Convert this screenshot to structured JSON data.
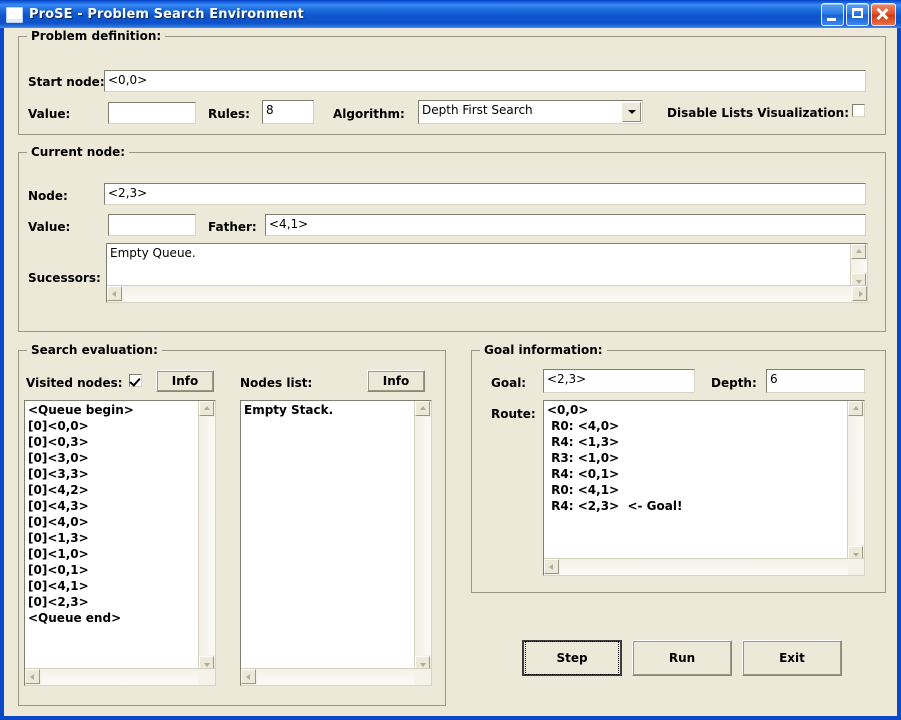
{
  "window": {
    "title": "ProSE - Problem Search Environment",
    "icon": "app-window-icon",
    "controls": {
      "minimize": "minimize-icon",
      "maximize": "maximize-icon",
      "close": "close-icon"
    },
    "colors": {
      "titlebar_blue": "#0d55cf",
      "titlebar_border": "#0a48c8",
      "face": "#ece9d8",
      "field_bg": "#ffffff",
      "close_red": "#cf3b14",
      "border_gray": "#9b9784"
    }
  },
  "problem_definition": {
    "legend": "Problem definition:",
    "start_node_label": "Start node:",
    "start_node_value": "<0,0>",
    "value_label": "Value:",
    "value_value": "",
    "rules_label": "Rules:",
    "rules_value": "8",
    "algorithm_label": "Algorithm:",
    "algorithm_value": "Depth First Search",
    "algorithm_options": [
      "Depth First Search"
    ],
    "disable_lists_label": "Disable Lists Visualization:",
    "disable_lists_checked": false
  },
  "current_node": {
    "legend": "Current node:",
    "node_label": "Node:",
    "node_value": "<2,3>",
    "value_label": "Value:",
    "value_value": "",
    "father_label": "Father:",
    "father_value": "<4,1>",
    "sucessors_label": "Sucessors:",
    "sucessors_text": "Empty Queue."
  },
  "search_evaluation": {
    "legend": "Search evaluation:",
    "visited_nodes_label": "Visited nodes:",
    "visited_nodes_checked": true,
    "visited_info_button": "Info",
    "nodes_list_label": "Nodes list:",
    "nodes_list_info_button": "Info",
    "visited_nodes_items": [
      "<Queue begin>",
      "[0]<0,0>",
      "[0]<0,3>",
      "[0]<3,0>",
      "[0]<3,3>",
      "[0]<4,2>",
      "[0]<4,3>",
      "[0]<4,0>",
      "[0]<1,3>",
      "[0]<1,0>",
      "[0]<0,1>",
      "[0]<4,1>",
      "[0]<2,3>",
      "<Queue end>"
    ],
    "nodes_list_items": [
      "Empty Stack."
    ]
  },
  "goal_information": {
    "legend": "Goal information:",
    "goal_label": "Goal:",
    "goal_value": "<2,3>",
    "depth_label": "Depth:",
    "depth_value": "6",
    "route_label": "Route:",
    "route_items": [
      "<0,0>",
      " R0: <4,0>",
      " R4: <1,3>",
      " R3: <1,0>",
      " R4: <0,1>",
      " R0: <4,1>",
      " R4: <2,3>  <- Goal!"
    ]
  },
  "actions": {
    "step_label": "Step",
    "run_label": "Run",
    "exit_label": "Exit",
    "default_button": "Step"
  }
}
